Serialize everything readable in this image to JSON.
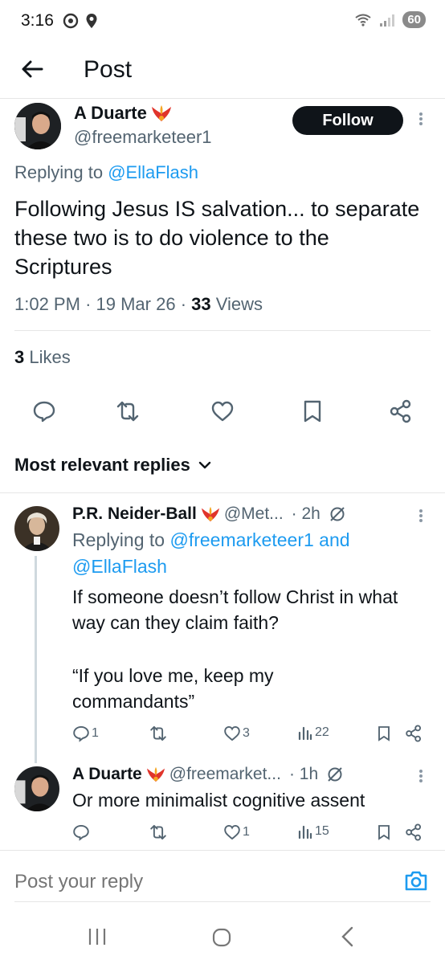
{
  "status_bar": {
    "time": "3:16",
    "battery": "60"
  },
  "header": {
    "title": "Post"
  },
  "main_post": {
    "author_name": "A Duarte",
    "author_handle": "@freemarketeer1",
    "follow_label": "Follow",
    "replying_prefix": "Replying to",
    "replying_to": "@EllaFlash",
    "text": "Following Jesus IS salvation... to separate these two is to do violence to the Scriptures",
    "time": "1:02 PM",
    "date": "19 Mar 26",
    "views_count": "33",
    "views_label": "Views",
    "likes_count": "3",
    "likes_label": "Likes",
    "sep": "·"
  },
  "replies_header": {
    "label": "Most relevant replies"
  },
  "replies": [
    {
      "author_name": "P.R. Neider-Ball",
      "author_handle": "@Met...",
      "age": "· 2h",
      "replying_prefix": "Replying to",
      "replying_to_1": "@freemarketeer1",
      "replying_and": "and",
      "replying_to_2": "@EllaFlash",
      "text_1": "If someone doesn’t follow Christ in what way can they claim faith?",
      "text_2": "“If you love me, keep my commandants”",
      "replies_count": "1",
      "reposts_count": "",
      "likes_count": "3",
      "views_count": "22"
    },
    {
      "author_name": "A Duarte",
      "author_handle": "@freemarket...",
      "age": "· 1h",
      "text_1": "Or more minimalist cognitive assent",
      "replies_count": "",
      "reposts_count": "",
      "likes_count": "1",
      "views_count": "15"
    }
  ],
  "reply_input": {
    "placeholder": "Post your reply"
  },
  "colors": {
    "accent": "#1d9bf0",
    "text": "#0f1419",
    "muted": "#536471",
    "divider": "#e6e6e6"
  }
}
